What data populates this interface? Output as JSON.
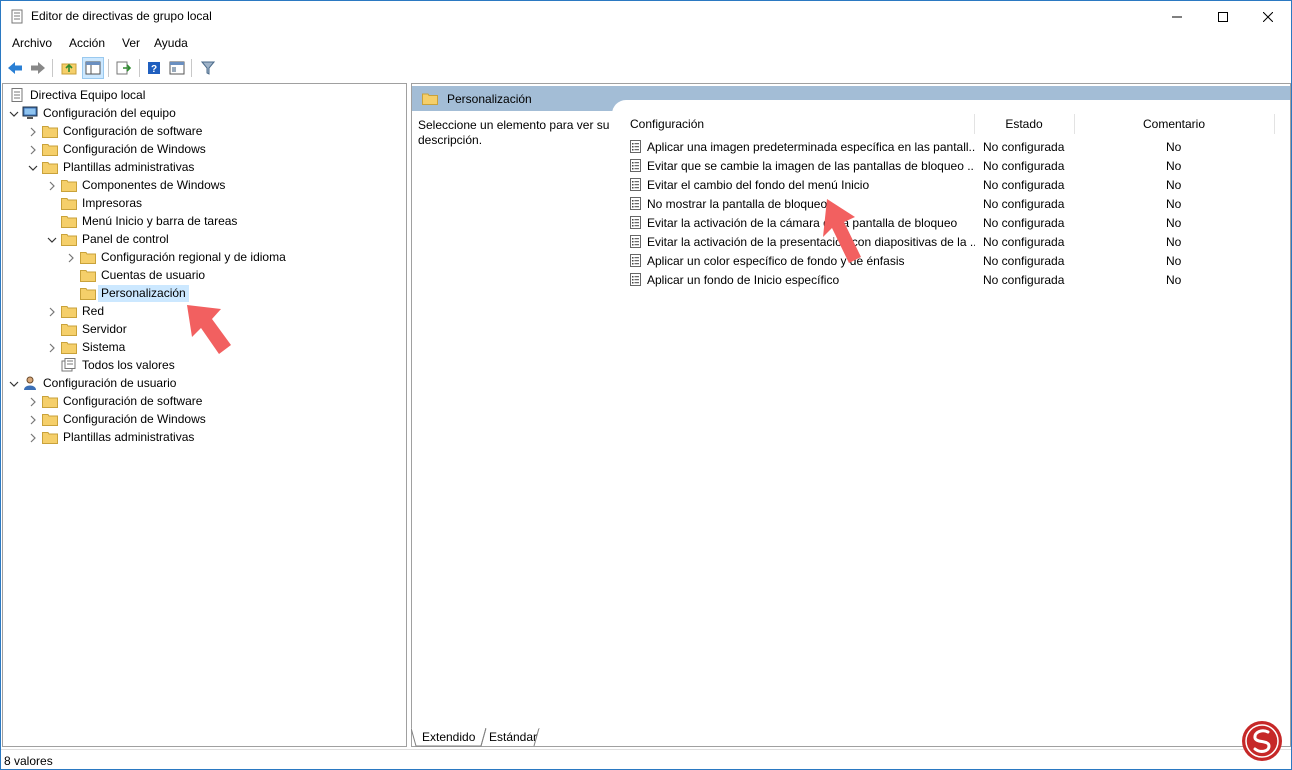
{
  "window": {
    "title": "Editor de directivas de grupo local",
    "controls": {
      "minimize": "minimize-icon",
      "maximize": "maximize-icon",
      "close": "close-icon"
    }
  },
  "menubar": [
    "Archivo",
    "Acción",
    "Ver",
    "Ayuda"
  ],
  "toolbar": [
    "back-arrow-icon",
    "forward-arrow-icon",
    "up-folder-icon",
    "show-hide-tree-icon",
    "export-list-icon",
    "help-icon",
    "view-icon",
    "filter-icon"
  ],
  "tree": [
    {
      "label": "Directiva Equipo local",
      "depth": 0,
      "expander": "none",
      "icon": "policy-document-icon"
    },
    {
      "label": "Configuración del equipo",
      "depth": 0,
      "expander": "expanded",
      "icon": "computer-icon"
    },
    {
      "label": "Configuración de software",
      "depth": 1,
      "expander": "collapsed",
      "icon": "folder-icon"
    },
    {
      "label": "Configuración de Windows",
      "depth": 1,
      "expander": "collapsed",
      "icon": "folder-icon"
    },
    {
      "label": "Plantillas administrativas",
      "depth": 1,
      "expander": "expanded",
      "icon": "folder-icon"
    },
    {
      "label": "Componentes de Windows",
      "depth": 2,
      "expander": "collapsed",
      "icon": "folder-icon"
    },
    {
      "label": "Impresoras",
      "depth": 2,
      "expander": "none",
      "icon": "folder-icon"
    },
    {
      "label": "Menú Inicio y barra de tareas",
      "depth": 2,
      "expander": "none",
      "icon": "folder-icon"
    },
    {
      "label": "Panel de control",
      "depth": 2,
      "expander": "expanded",
      "icon": "folder-icon"
    },
    {
      "label": "Configuración regional y de idioma",
      "depth": 3,
      "expander": "collapsed",
      "icon": "folder-icon"
    },
    {
      "label": "Cuentas de usuario",
      "depth": 3,
      "expander": "none",
      "icon": "folder-icon"
    },
    {
      "label": "Personalización",
      "depth": 3,
      "expander": "none",
      "icon": "folder-icon",
      "selected": true
    },
    {
      "label": "Red",
      "depth": 2,
      "expander": "collapsed",
      "icon": "folder-icon"
    },
    {
      "label": "Servidor",
      "depth": 2,
      "expander": "none",
      "icon": "folder-icon"
    },
    {
      "label": "Sistema",
      "depth": 2,
      "expander": "collapsed",
      "icon": "folder-icon"
    },
    {
      "label": "Todos los valores",
      "depth": 2,
      "expander": "none",
      "icon": "all-settings-icon"
    },
    {
      "label": "Configuración de usuario",
      "depth": 0,
      "expander": "expanded",
      "icon": "user-icon"
    },
    {
      "label": "Configuración de software",
      "depth": 1,
      "expander": "collapsed",
      "icon": "folder-icon"
    },
    {
      "label": "Configuración de Windows",
      "depth": 1,
      "expander": "collapsed",
      "icon": "folder-icon"
    },
    {
      "label": "Plantillas administrativas",
      "depth": 1,
      "expander": "collapsed",
      "icon": "folder-icon"
    }
  ],
  "details": {
    "header": "Personalización",
    "description": "Seleccione un elemento para ver su descripción.",
    "columns": {
      "config": "Configuración",
      "state": "Estado",
      "comment": "Comentario"
    },
    "rows": [
      {
        "name": "Aplicar una imagen predeterminada específica en las pantall...",
        "state": "No configurada",
        "comment": "No"
      },
      {
        "name": "Evitar que se cambie la imagen de las pantallas de bloqueo ...",
        "state": "No configurada",
        "comment": "No"
      },
      {
        "name": "Evitar el cambio del fondo del menú Inicio",
        "state": "No configurada",
        "comment": "No"
      },
      {
        "name": "No mostrar la pantalla de bloqueo",
        "state": "No configurada",
        "comment": "No"
      },
      {
        "name": "Evitar la activación de la cámara de la pantalla de bloqueo",
        "state": "No configurada",
        "comment": "No"
      },
      {
        "name": "Evitar la activación de la presentación con diapositivas de la ...",
        "state": "No configurada",
        "comment": "No"
      },
      {
        "name": "Aplicar un color específico de fondo y de énfasis",
        "state": "No configurada",
        "comment": "No"
      },
      {
        "name": "Aplicar un fondo de Inicio específico",
        "state": "No configurada",
        "comment": "No"
      }
    ]
  },
  "tabs": [
    "Extendido",
    "Estándar"
  ],
  "status": "8 valores",
  "colors": {
    "header_band": "#a3bdd6",
    "selection": "#cce8ff",
    "folder": "#f5cf6a",
    "pointer": "#f05a5a",
    "watermark": "#c62828"
  }
}
